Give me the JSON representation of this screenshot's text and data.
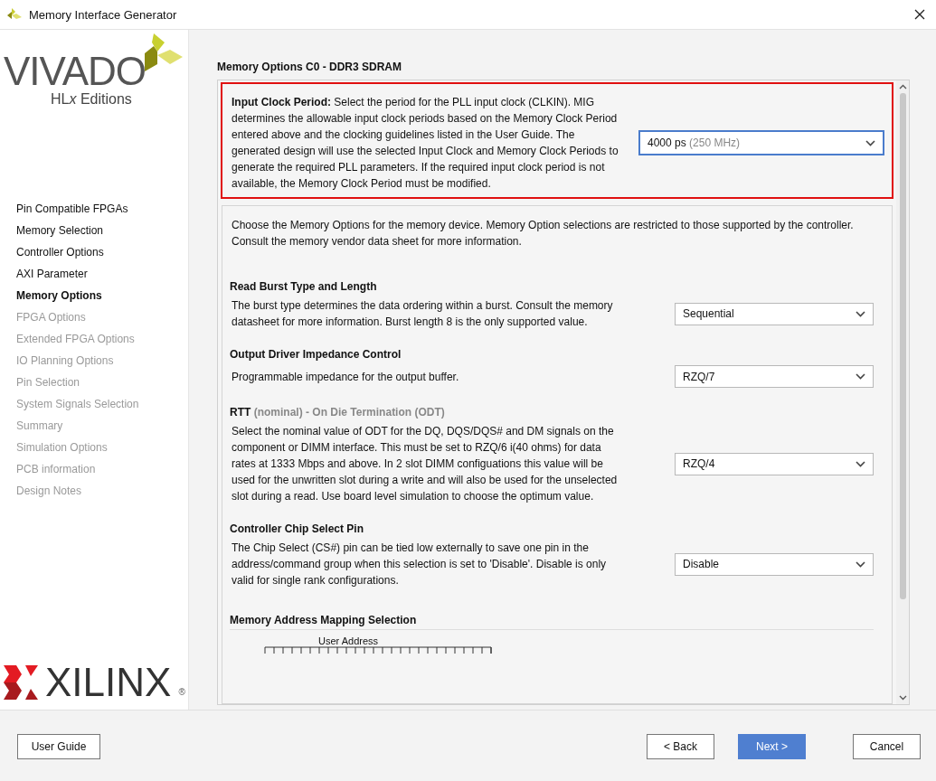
{
  "window": {
    "title": "Memory Interface Generator"
  },
  "branding": {
    "product": "VIVADO",
    "edition_prefix": "HL",
    "edition_italic": "x",
    "edition_suffix": " Editions",
    "company": "XILINX",
    "registered": "®"
  },
  "sidebar": {
    "items": [
      {
        "label": "Pin Compatible FPGAs",
        "selected": false,
        "disabled": false
      },
      {
        "label": "Memory Selection",
        "selected": false,
        "disabled": false
      },
      {
        "label": "Controller Options",
        "selected": false,
        "disabled": false
      },
      {
        "label": "AXI Parameter",
        "selected": false,
        "disabled": false
      },
      {
        "label": "Memory Options",
        "selected": true,
        "disabled": false
      },
      {
        "label": "FPGA Options",
        "selected": false,
        "disabled": true
      },
      {
        "label": "Extended FPGA Options",
        "selected": false,
        "disabled": true
      },
      {
        "label": "IO Planning Options",
        "selected": false,
        "disabled": true
      },
      {
        "label": "Pin Selection",
        "selected": false,
        "disabled": true
      },
      {
        "label": "System Signals Selection",
        "selected": false,
        "disabled": true
      },
      {
        "label": "Summary",
        "selected": false,
        "disabled": true
      },
      {
        "label": "Simulation Options",
        "selected": false,
        "disabled": true
      },
      {
        "label": "PCB information",
        "selected": false,
        "disabled": true
      },
      {
        "label": "Design Notes",
        "selected": false,
        "disabled": true
      }
    ]
  },
  "page_title": "Memory Options C0 - DDR3 SDRAM",
  "clock_box": {
    "description": "**Input Clock Period:** Select the period for the PLL input clock (CLKIN). MIG determines the allowable input clock periods based on the Memory Clock Period entered above and the clocking guidelines listed in the User Guide. The generated design will use the selected Input Clock and Memory Clock Periods to generate the required PLL parameters. If the required input clock period is not available, the Memory Clock Period must be modified.",
    "highlighted": true,
    "dropdown": {
      "value": "4000 ps",
      "hint": "(250 MHz)",
      "focused": true
    }
  },
  "intro": "Choose the Memory Options for the memory device. Memory Option selections are restricted to those supported by the controller. Consult the memory vendor data sheet for more information.",
  "sections": [
    {
      "title": "Read Burst Type and Length",
      "description": "The burst type determines the data ordering within a burst. Consult the memory datasheet for more information. Burst length 8 is the only supported value.",
      "value": "Sequential"
    },
    {
      "title": "Output Driver Impedance Control",
      "description": "Programmable impedance for the output buffer.",
      "value": "RZQ/7"
    },
    {
      "title": "RTT",
      "subtitle": "(nominal) - On Die Termination (ODT)",
      "description": "Select the nominal value of ODT for the DQ, DQS/DQS# and DM signals on the component or DIMM interface. This must be set to RZQ/6 i(40 ohms) for data rates at 1333 Mbps and above. In 2 slot DIMM configuations this value will be used for the unwritten slot during a write and will also be used for the unselected slot during a read. Use board level simulation to choose the optimum value.",
      "value": "RZQ/4"
    },
    {
      "title": "Controller Chip Select Pin",
      "description": "The Chip Select (CS#) pin can be tied low externally to save one pin in the address/command group when this selection is set to 'Disable'. Disable is only valid for single rank configurations.",
      "value": "Disable"
    }
  ],
  "mapping": {
    "title": "Memory Address Mapping Selection",
    "label": "User Address"
  },
  "buttons": {
    "left": [
      {
        "label": "User Guide",
        "primary": false
      }
    ],
    "right": [
      {
        "label": "< Back",
        "primary": false
      },
      {
        "label": "Next >",
        "primary": true
      },
      {
        "label": "Cancel",
        "primary": false
      }
    ]
  }
}
